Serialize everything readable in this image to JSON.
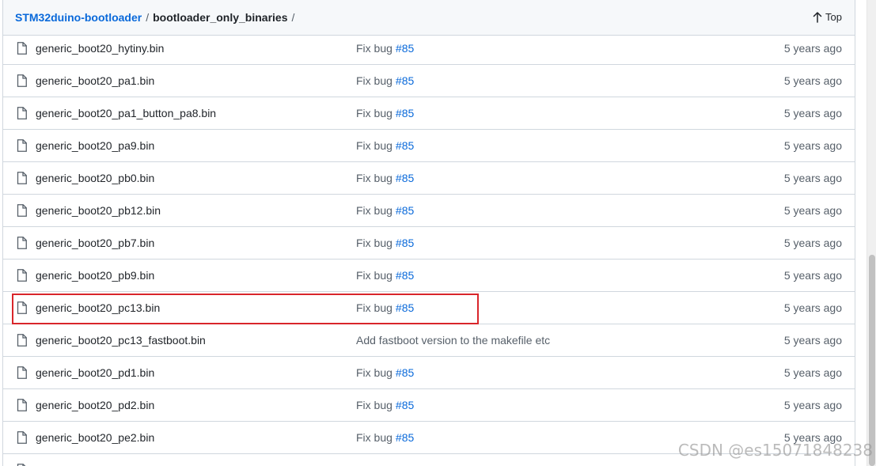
{
  "breadcrumb": {
    "repo": "STM32duino-bootloader",
    "folder": "bootloader_only_binaries",
    "separator": "/"
  },
  "top_link": {
    "label": "Top",
    "icon": "arrow-up-icon"
  },
  "colors": {
    "link": "#0969da",
    "highlight": "#d9262b"
  },
  "files": [
    {
      "name": "generic_boot20_hytiny.bin",
      "message": "Fix bug",
      "issue": "#85",
      "age": "5 years ago"
    },
    {
      "name": "generic_boot20_pa1.bin",
      "message": "Fix bug",
      "issue": "#85",
      "age": "5 years ago"
    },
    {
      "name": "generic_boot20_pa1_button_pa8.bin",
      "message": "Fix bug",
      "issue": "#85",
      "age": "5 years ago"
    },
    {
      "name": "generic_boot20_pa9.bin",
      "message": "Fix bug",
      "issue": "#85",
      "age": "5 years ago"
    },
    {
      "name": "generic_boot20_pb0.bin",
      "message": "Fix bug",
      "issue": "#85",
      "age": "5 years ago"
    },
    {
      "name": "generic_boot20_pb12.bin",
      "message": "Fix bug",
      "issue": "#85",
      "age": "5 years ago"
    },
    {
      "name": "generic_boot20_pb7.bin",
      "message": "Fix bug",
      "issue": "#85",
      "age": "5 years ago"
    },
    {
      "name": "generic_boot20_pb9.bin",
      "message": "Fix bug",
      "issue": "#85",
      "age": "5 years ago"
    },
    {
      "name": "generic_boot20_pc13.bin",
      "message": "Fix bug",
      "issue": "#85",
      "age": "5 years ago"
    },
    {
      "name": "generic_boot20_pc13_fastboot.bin",
      "message": "Add fastboot version to the makefile etc",
      "issue": "",
      "age": "5 years ago"
    },
    {
      "name": "generic_boot20_pd1.bin",
      "message": "Fix bug",
      "issue": "#85",
      "age": "5 years ago"
    },
    {
      "name": "generic_boot20_pd2.bin",
      "message": "Fix bug",
      "issue": "#85",
      "age": "5 years ago"
    },
    {
      "name": "generic_boot20_pe2.bin",
      "message": "Fix bug",
      "issue": "#85",
      "age": "5 years ago"
    },
    {
      "name": "",
      "message": "",
      "issue": "",
      "age": ""
    }
  ],
  "watermark": "CSDN @es15071848238"
}
